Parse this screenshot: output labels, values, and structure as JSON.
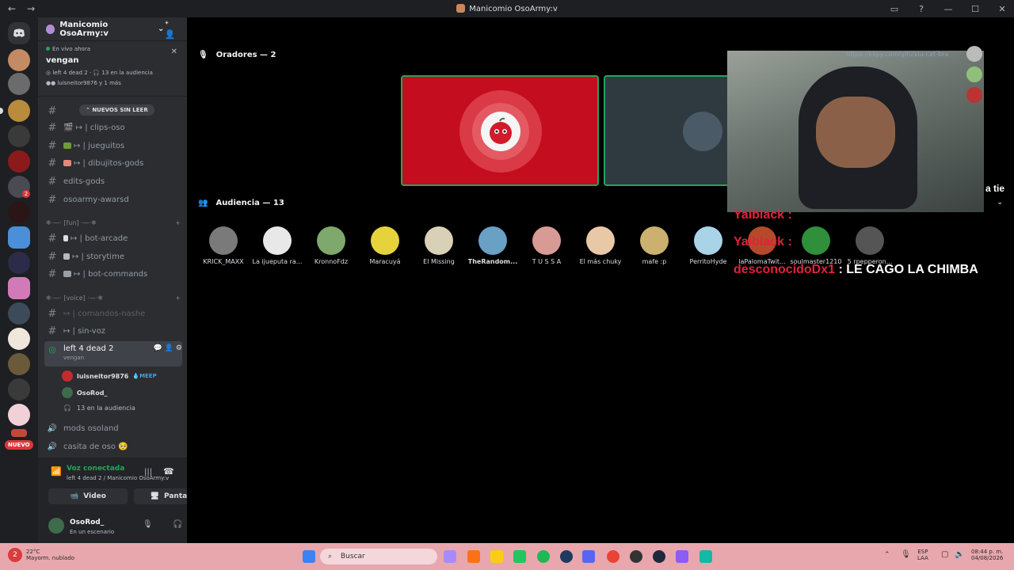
{
  "window": {
    "title": "Manicomio OsoArmy:v",
    "back": "←",
    "forward": "→"
  },
  "server": {
    "name": "Manicomio OsoArmy:v",
    "chevron": "⌄",
    "new_badge": "NUEVO",
    "notif_count": "2"
  },
  "live": {
    "label": "En vivo ahora",
    "stage": "vengan",
    "meta_stage": "left 4 dead 2",
    "meta_audience": "13 en la audiencia",
    "participants": "luisneitor9876 y 1 más"
  },
  "unread_pill": "NUEVOS SIN LEER",
  "channels_top": [
    {
      "icon": "#",
      "label": "🎬 ↦ | clips-oso"
    },
    {
      "icon": "#",
      "label": "↦ | jueguitos"
    },
    {
      "icon": "#",
      "label": "↦ | dibujitos-gods"
    },
    {
      "icon": "#",
      "label": "edits-gods"
    },
    {
      "icon": "#",
      "label": "osoarmy-awarsd"
    }
  ],
  "cat_fun": "❄·—· [fun] ·—·❄",
  "channels_fun": [
    {
      "icon": "#",
      "label": "↦ | bot-arcade"
    },
    {
      "icon": "#",
      "label": "↦ | storytime"
    },
    {
      "icon": "#",
      "label": "↦ | bot-commands"
    }
  ],
  "cat_voice": "❄·—· [voice] ·—·❄",
  "channels_voice": [
    {
      "icon": "#",
      "label": "↦ | comandos-nashe"
    },
    {
      "icon": "#",
      "label": "↦ | sin-voz"
    }
  ],
  "active_stage": {
    "name": "left 4 dead 2",
    "topic": "vengan"
  },
  "stage_users": [
    {
      "name": "luisneitor9876",
      "tag": "MEEP"
    },
    {
      "name": "OsoRod_"
    }
  ],
  "stage_audience_line": "13 en la audiencia",
  "more_voice": [
    {
      "label": "mods osoland"
    },
    {
      "label": "casita de oso 🥺"
    }
  ],
  "voice_panel": {
    "status": "Voz conectada",
    "sub": "left 4 dead 2 / Manicomio OsoArmy:v",
    "video": "Video",
    "screen": "Pantalla"
  },
  "me": {
    "name": "OsoRod_",
    "status": "En un escenario"
  },
  "speakers_title": "Oradores — 2",
  "audience_title": "Audiencia — 13",
  "audience": [
    {
      "name": "KRICK_MAXX",
      "color": "#7a7a7a"
    },
    {
      "name": "La ijueputa ra...",
      "color": "#e8e8e8"
    },
    {
      "name": "KronnoFdz",
      "color": "#7fa86c"
    },
    {
      "name": "Maracuyá",
      "color": "#e6d23a"
    },
    {
      "name": "El Missing",
      "color": "#d9d0b8"
    },
    {
      "name": "TheRandom...",
      "color": "#6aa0c4"
    },
    {
      "name": "T U S S A",
      "color": "#d89a94"
    },
    {
      "name": "El más chuky",
      "color": "#e9c8a8"
    },
    {
      "name": "mafe :p",
      "color": "#cbb070"
    },
    {
      "name": "PerritoHyde",
      "color": "#a9d3e6"
    },
    {
      "name": "laPalomaTwit...",
      "color": "#b44a2a"
    },
    {
      "name": "soulmaster1210",
      "color": "#2f8f3a"
    },
    {
      "name": "5 rpepperon...",
      "color": "#555"
    }
  ],
  "overlay": {
    "url": "https://klipy.com/gifs/xiu-cat-bra",
    "line1": "Yaiblack :",
    "line2": "Yaiblack :",
    "line3_user": "desconocidoDx1",
    "line3_msg": " : LE CAGO LA CHIMBA",
    "edge": "a tie"
  },
  "taskbar": {
    "temp": "22°C",
    "weather": "Mayorm. nublado",
    "search": "Buscar",
    "lang": "ESP",
    "lang2": "LAA",
    "time": "08:44 p. m.",
    "date": "04/08/2026",
    "weather_badge": "2"
  },
  "colors": {
    "accent_green": "#23a55a",
    "tile_red": "#c40d1e",
    "taskbar": "#e8a7ad",
    "overlay_red": "#e0223a"
  }
}
